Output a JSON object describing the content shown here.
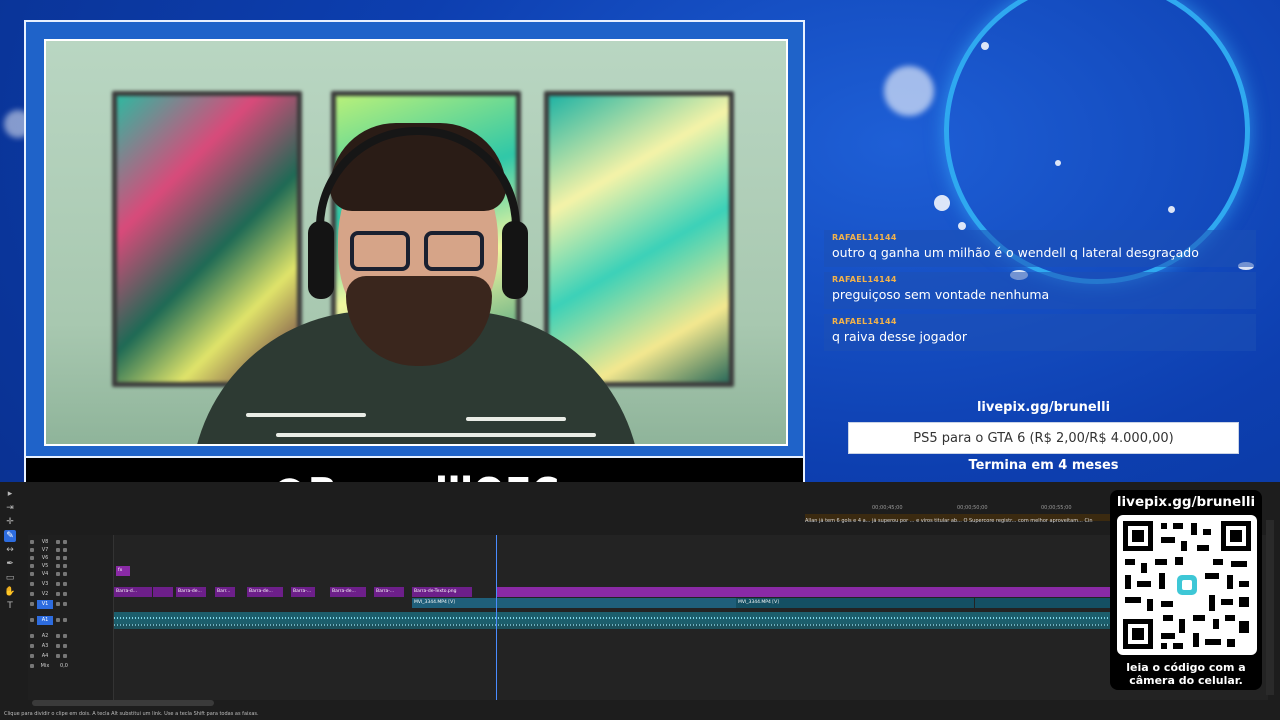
{
  "overlay": {
    "handle": "@BrunelliOFC",
    "goal": {
      "url": "livepix.gg/brunelli",
      "text": "PS5 para o GTA 6 (R$ 2,00/R$ 4.000,00)",
      "ends": "Termina em 4 meses"
    },
    "qr": {
      "url": "livepix.gg/brunelli",
      "caption_line1": "leia o código com a",
      "caption_line2": "câmera do celular."
    }
  },
  "chat": {
    "messages": [
      {
        "user": "RAFAEL14144",
        "text": "outro q ganha um milhão é o wendell q lateral desgraçado"
      },
      {
        "user": "RAFAEL14144",
        "text": "preguiçoso sem vontade nenhuma"
      },
      {
        "user": "RAFAEL14144",
        "text": "q raiva desse jogador"
      }
    ]
  },
  "timeline": {
    "ruler_ticks": [
      "00;00;45;00",
      "00;00;50;00",
      "00;00;55;00"
    ],
    "ruler_clips": "Allan já tem 6 gols e 4 a...   já superou por ...   e viros titular ab...   O Supercore registr...   com melhor aproveitam...   Cin",
    "tracks": [
      "V8",
      "V7",
      "V6",
      "V5",
      "V4",
      "V3",
      "V2",
      "V1",
      "A1",
      "A2",
      "A3",
      "A4",
      "Mix"
    ],
    "track_values": {
      "mix": "0,0"
    },
    "clips": {
      "c1": "Barra-d...",
      "c2": "Barra-de...",
      "c3": "Barr...",
      "c4": "Barra-de...",
      "c5": "Barra-...",
      "c6": "Barra-de...",
      "c7": "Barra-...",
      "c8": "Barra-de-Texto.png",
      "v1a": "MVI_3344.MP4 [V]",
      "v1b": "MVI_3344.MP4 [V]"
    },
    "status_text": "Clique para dividir o clipe em dois. A tecla Alt substitui um link. Use a tecla Shift para todas as faixas."
  },
  "tools": [
    "selection-tool",
    "track-select-tool",
    "ripple-edit-tool",
    "razor-tool",
    "slip-tool",
    "pen-tool",
    "rectangle-tool",
    "hand-tool",
    "type-tool"
  ]
}
